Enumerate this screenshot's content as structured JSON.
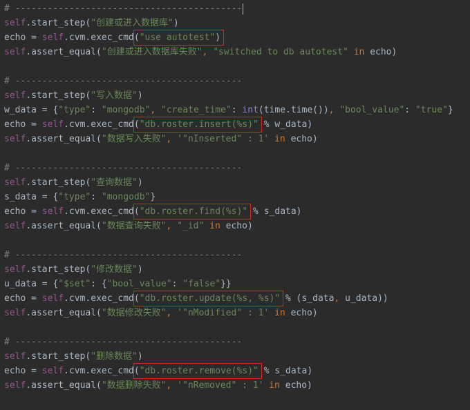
{
  "colors": {
    "background": "#2b2b2b",
    "default": "#a9b7c6",
    "self": "#94558d",
    "string": "#6a8759",
    "keyword": "#cc7832",
    "builtin": "#8888c6",
    "comment": "#808080",
    "highlight_box": "#e0241c"
  },
  "lines": [
    [
      [
        "c",
        "# ------------------------------------------"
      ],
      [
        "cursor",
        ""
      ]
    ],
    [
      [
        "s",
        "self"
      ],
      [
        "d",
        ".start_step("
      ],
      [
        "str",
        "\"创建或进入数据库\""
      ],
      [
        "d",
        ")"
      ]
    ],
    [
      [
        "s",
        "echo = "
      ],
      [
        "s",
        "self"
      ],
      [
        "d",
        ".cvm.exec_cmd"
      ],
      {
        "box": [
          [
            "d",
            "("
          ],
          [
            "str",
            "\"use autotest\""
          ],
          [
            "d",
            ")"
          ]
        ]
      }
    ],
    [
      [
        "s",
        "self"
      ],
      [
        "d",
        ".assert_equal("
      ],
      [
        "str",
        "\"创建或进入数据库失败\""
      ],
      [
        "k",
        ", "
      ],
      [
        "str",
        "\"switched to db autotest\""
      ],
      [
        "k",
        " in "
      ],
      [
        "d",
        "echo)"
      ]
    ],
    [],
    [
      [
        "c",
        "# ------------------------------------------"
      ]
    ],
    [
      [
        "s",
        "self"
      ],
      [
        "d",
        ".start_step("
      ],
      [
        "str",
        "\"写入数据\""
      ],
      [
        "d",
        ")"
      ]
    ],
    [
      [
        "d",
        "w_data = {"
      ],
      [
        "str",
        "\"type\""
      ],
      [
        "d",
        ": "
      ],
      [
        "str",
        "\"mongodb\""
      ],
      [
        "k",
        ", "
      ],
      [
        "str",
        "\"create_time\""
      ],
      [
        "d",
        ": "
      ],
      [
        "b",
        "int"
      ],
      [
        "d",
        "(time.time())"
      ],
      [
        "k",
        ", "
      ],
      [
        "str",
        "\"bool_value\""
      ],
      [
        "d",
        ": "
      ],
      [
        "str",
        "\"true\""
      ],
      [
        "d",
        "}"
      ]
    ],
    [
      [
        "d",
        "echo = "
      ],
      [
        "s",
        "self"
      ],
      [
        "d",
        ".cvm.exec_cmd"
      ],
      {
        "box": [
          [
            "d",
            "("
          ],
          [
            "str",
            "\"db.roster.insert(%s)\""
          ]
        ]
      },
      [
        "d",
        " % w_data)"
      ]
    ],
    [
      [
        "s",
        "self"
      ],
      [
        "d",
        ".assert_equal("
      ],
      [
        "str",
        "\"数据写入失败\""
      ],
      [
        "k",
        ", "
      ],
      [
        "str",
        "'\"nInserted\" : 1'"
      ],
      [
        "k",
        " in "
      ],
      [
        "d",
        "echo)"
      ]
    ],
    [],
    [
      [
        "c",
        "# ------------------------------------------"
      ]
    ],
    [
      [
        "s",
        "self"
      ],
      [
        "d",
        ".start_step("
      ],
      [
        "str",
        "\"查询数据\""
      ],
      [
        "d",
        ")"
      ]
    ],
    [
      [
        "d",
        "s_data = {"
      ],
      [
        "str",
        "\"type\""
      ],
      [
        "d",
        ": "
      ],
      [
        "str",
        "\"mongodb\""
      ],
      [
        "d",
        "}"
      ]
    ],
    [
      [
        "d",
        "echo = "
      ],
      [
        "s",
        "self"
      ],
      [
        "d",
        ".cvm.exec_cmd"
      ],
      {
        "box": [
          [
            "d",
            "("
          ],
          [
            "str",
            "\"db.roster.find(%s)\""
          ]
        ]
      },
      [
        "d",
        " % s_data)"
      ]
    ],
    [
      [
        "s",
        "self"
      ],
      [
        "d",
        ".assert_equal("
      ],
      [
        "str",
        "\"数据查询失败\""
      ],
      [
        "k",
        ", "
      ],
      [
        "str",
        "\"_id\""
      ],
      [
        "k",
        " in "
      ],
      [
        "d",
        "echo)"
      ]
    ],
    [],
    [
      [
        "c",
        "# ------------------------------------------"
      ]
    ],
    [
      [
        "s",
        "self"
      ],
      [
        "d",
        ".start_step("
      ],
      [
        "str",
        "\"修改数据\""
      ],
      [
        "d",
        ")"
      ]
    ],
    [
      [
        "d",
        "u_data = {"
      ],
      [
        "str",
        "\"$set\""
      ],
      [
        "d",
        ": {"
      ],
      [
        "str",
        "\"bool_value\""
      ],
      [
        "d",
        ": "
      ],
      [
        "str",
        "\"false\""
      ],
      [
        "d",
        "}}"
      ]
    ],
    [
      [
        "d",
        "echo = "
      ],
      [
        "s",
        "self"
      ],
      [
        "d",
        ".cvm.exec_cmd"
      ],
      {
        "box": [
          [
            "d",
            "("
          ],
          [
            "str",
            "\"db.roster.update(%s, %s)\""
          ]
        ]
      },
      [
        "d",
        " % (s_data"
      ],
      [
        "k",
        ", "
      ],
      [
        "d",
        "u_data))"
      ]
    ],
    [
      [
        "s",
        "self"
      ],
      [
        "d",
        ".assert_equal("
      ],
      [
        "str",
        "\"数据修改失败\""
      ],
      [
        "k",
        ", "
      ],
      [
        "str",
        "'\"nModified\" : 1'"
      ],
      [
        "k",
        " in "
      ],
      [
        "d",
        "echo)"
      ]
    ],
    [],
    [
      [
        "c",
        "# ------------------------------------------"
      ]
    ],
    [
      [
        "s",
        "self"
      ],
      [
        "d",
        ".start_step("
      ],
      [
        "str",
        "\"删除数据\""
      ],
      [
        "d",
        ")"
      ]
    ],
    [
      [
        "d",
        "echo = "
      ],
      [
        "s",
        "self"
      ],
      [
        "d",
        ".cvm.exec_cmd"
      ],
      {
        "box": [
          [
            "d",
            "("
          ],
          [
            "str",
            "\"db.roster.remove(%s)\""
          ]
        ]
      },
      [
        "d",
        " % s_data)"
      ]
    ],
    [
      [
        "s",
        "self"
      ],
      [
        "d",
        ".assert_equal("
      ],
      [
        "str",
        "\"数据删除失败\""
      ],
      [
        "k",
        ", "
      ],
      [
        "str",
        "'\"nRemoved\" : 1'"
      ],
      [
        "k",
        " in "
      ],
      [
        "d",
        "echo)"
      ]
    ]
  ]
}
